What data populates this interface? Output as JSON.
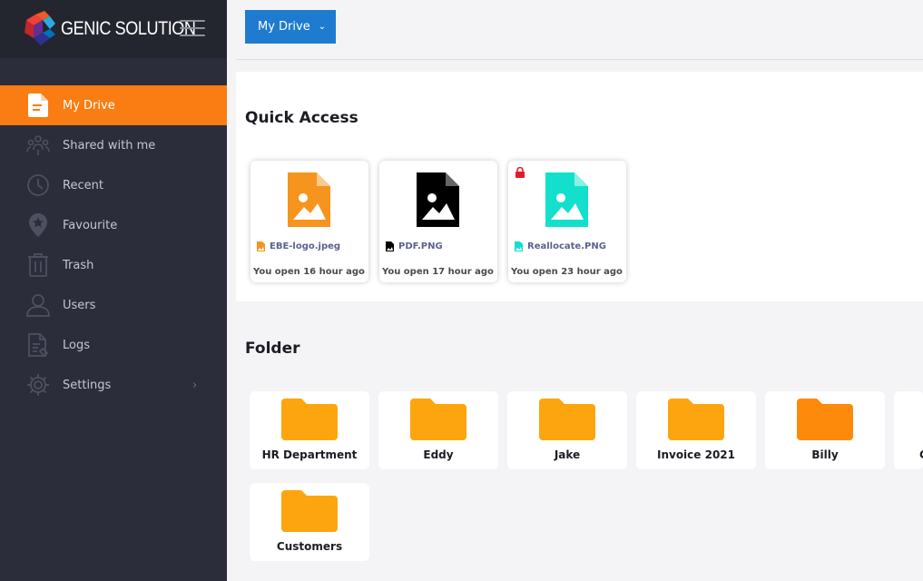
{
  "brand": {
    "name": "GENIC SOLUTION"
  },
  "sidebar": {
    "items": [
      {
        "label": "My Drive",
        "icon": "document-icon",
        "active": true
      },
      {
        "label": "Shared with me",
        "icon": "share-users-icon"
      },
      {
        "label": "Recent",
        "icon": "clock-icon"
      },
      {
        "label": "Favourite",
        "icon": "star-pin-icon"
      },
      {
        "label": "Trash",
        "icon": "trash-icon"
      },
      {
        "label": "Users",
        "icon": "user-icon"
      },
      {
        "label": "Logs",
        "icon": "logs-icon"
      },
      {
        "label": "Settings",
        "icon": "gear-icon",
        "chevron": "›"
      }
    ]
  },
  "toolbar": {
    "drive_label": "My Drive",
    "caret": "⌄"
  },
  "quick_access": {
    "title": "Quick Access",
    "files": [
      {
        "name": "EBE-logo.jpeg",
        "time": "You open 16 hour ago",
        "color": "#f7941d",
        "locked": false
      },
      {
        "name": "PDF.PNG",
        "time": "You open 17 hour ago",
        "color": "#000000",
        "locked": false
      },
      {
        "name": "Reallocate.PNG",
        "time": "You open 23 hour ago",
        "color": "#13e0cc",
        "locked": true
      }
    ]
  },
  "folders": {
    "title": "Folder",
    "items": [
      {
        "name": "HR Department"
      },
      {
        "name": "Eddy"
      },
      {
        "name": "Jake"
      },
      {
        "name": "Invoice 2021"
      },
      {
        "name": "Billy"
      },
      {
        "name": "C"
      },
      {
        "name": "Customers"
      }
    ]
  },
  "colors": {
    "accent": "#f97d12",
    "primary": "#1e7bd0",
    "folder": "#fda50f",
    "sidebar": "#2b2d3b",
    "lock": "#e31b2b"
  }
}
